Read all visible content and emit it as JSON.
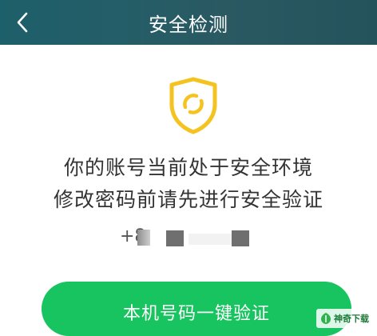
{
  "header": {
    "title": "安全检测",
    "back_icon": "chevron-left-icon"
  },
  "status": {
    "icon": "shield-icon",
    "line1": "你的账号当前处于安全环境",
    "line2": "修改密码前请先进行安全验证"
  },
  "phone": {
    "prefix": "+8"
  },
  "actions": {
    "verify_label": "本机号码一键验证"
  },
  "watermark": {
    "text": "神奇下载"
  },
  "colors": {
    "header_start": "#1d5f6a",
    "header_end": "#25535c",
    "accent_green": "#18c45f",
    "shield_yellow": "#f5c31f"
  }
}
